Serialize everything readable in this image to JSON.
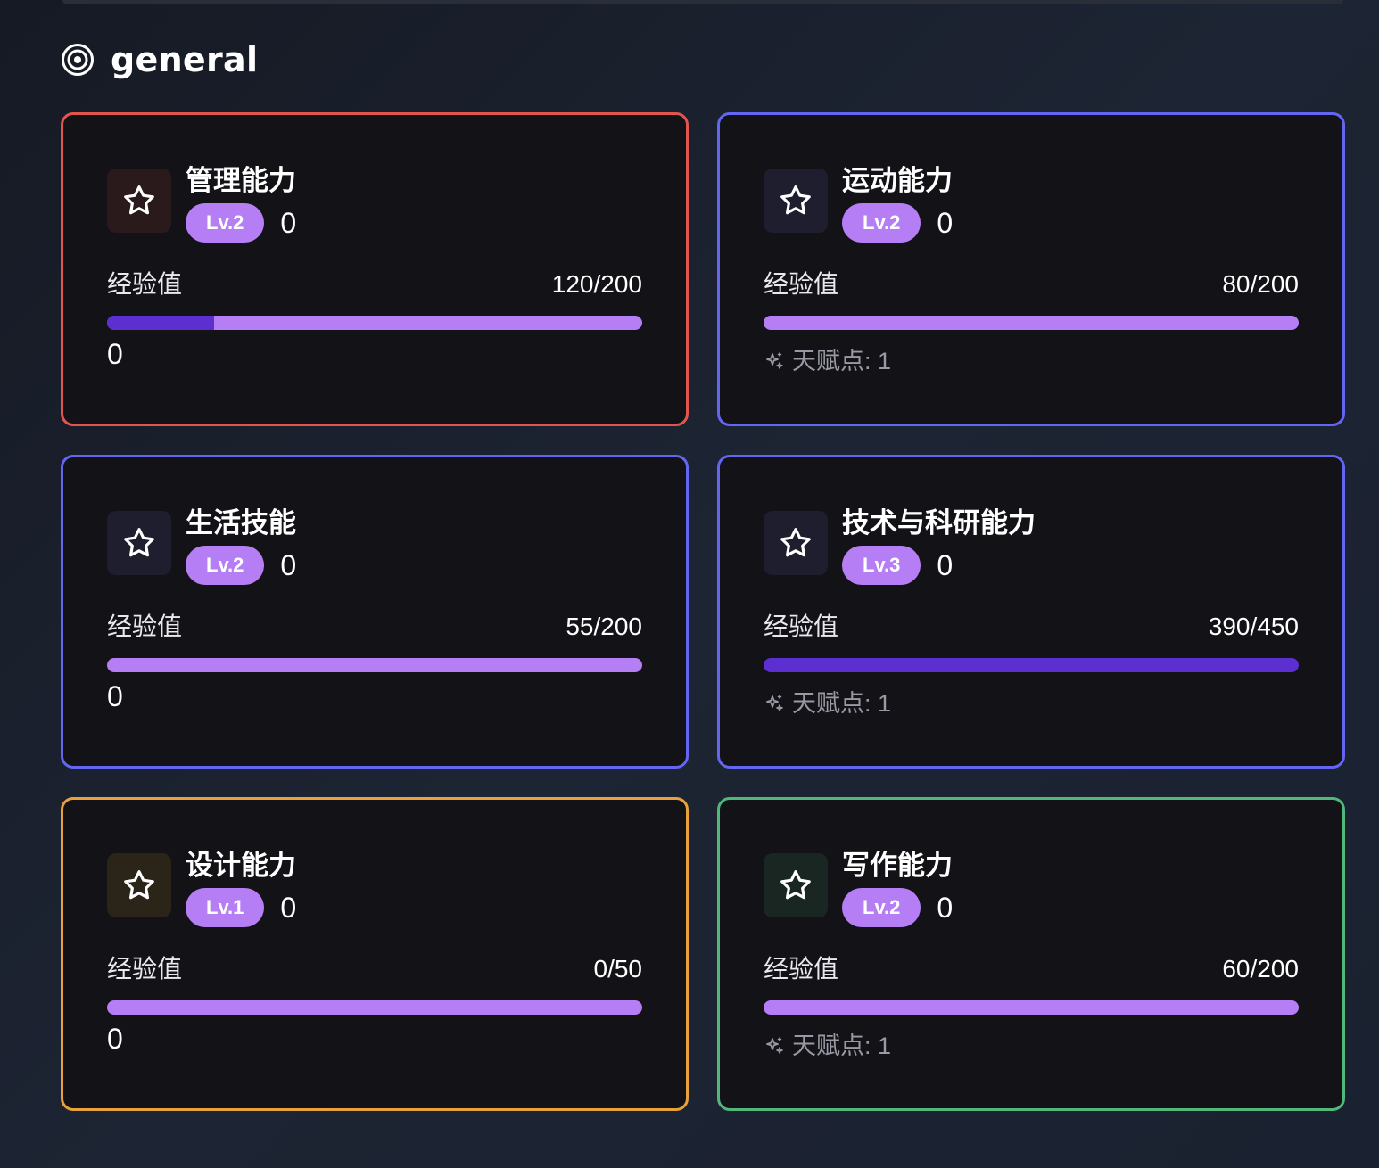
{
  "section": {
    "title": "general",
    "icon": "target-icon"
  },
  "cards": [
    {
      "title": "管理能力",
      "level": "Lv.2",
      "level_value": "0",
      "xp_label": "经验值",
      "xp_value": "120/200",
      "progress": 0.2,
      "bottom_text": "0",
      "talent": null,
      "border_color": "#e0564f",
      "icon_bg": "#2b1a1c",
      "icon": "star-icon"
    },
    {
      "title": "运动能力",
      "level": "Lv.2",
      "level_value": "0",
      "xp_label": "经验值",
      "xp_value": "80/200",
      "progress": 0,
      "bottom_text": null,
      "talent": "天赋点: 1",
      "border_color": "#6366f1",
      "icon_bg": "#1e1e2e",
      "icon": "star-icon"
    },
    {
      "title": "生活技能",
      "level": "Lv.2",
      "level_value": "0",
      "xp_label": "经验值",
      "xp_value": "55/200",
      "progress": 0,
      "bottom_text": "0",
      "talent": null,
      "border_color": "#6366f1",
      "icon_bg": "#1e1e2e",
      "icon": "star-icon"
    },
    {
      "title": "技术与科研能力",
      "level": "Lv.3",
      "level_value": "0",
      "xp_label": "经验值",
      "xp_value": "390/450",
      "progress": 1,
      "bottom_text": null,
      "talent": "天赋点: 1",
      "border_color": "#6366f1",
      "icon_bg": "#1e1e2e",
      "icon": "star-icon"
    },
    {
      "title": "设计能力",
      "level": "Lv.1",
      "level_value": "0",
      "xp_label": "经验值",
      "xp_value": "0/50",
      "progress": 0,
      "bottom_text": "0",
      "talent": null,
      "border_color": "#e9a23b",
      "icon_bg": "#2b2418",
      "icon": "star-icon"
    },
    {
      "title": "写作能力",
      "level": "Lv.2",
      "level_value": "0",
      "xp_label": "经验值",
      "xp_value": "60/200",
      "progress": 0,
      "bottom_text": null,
      "talent": "天赋点: 1",
      "border_color": "#4fb87a",
      "icon_bg": "#1a2622",
      "icon": "star-icon"
    }
  ],
  "colors": {
    "badge": "#b57ef5",
    "bar_track": "#b57ef5",
    "bar_fill": "#5b2fd0"
  }
}
